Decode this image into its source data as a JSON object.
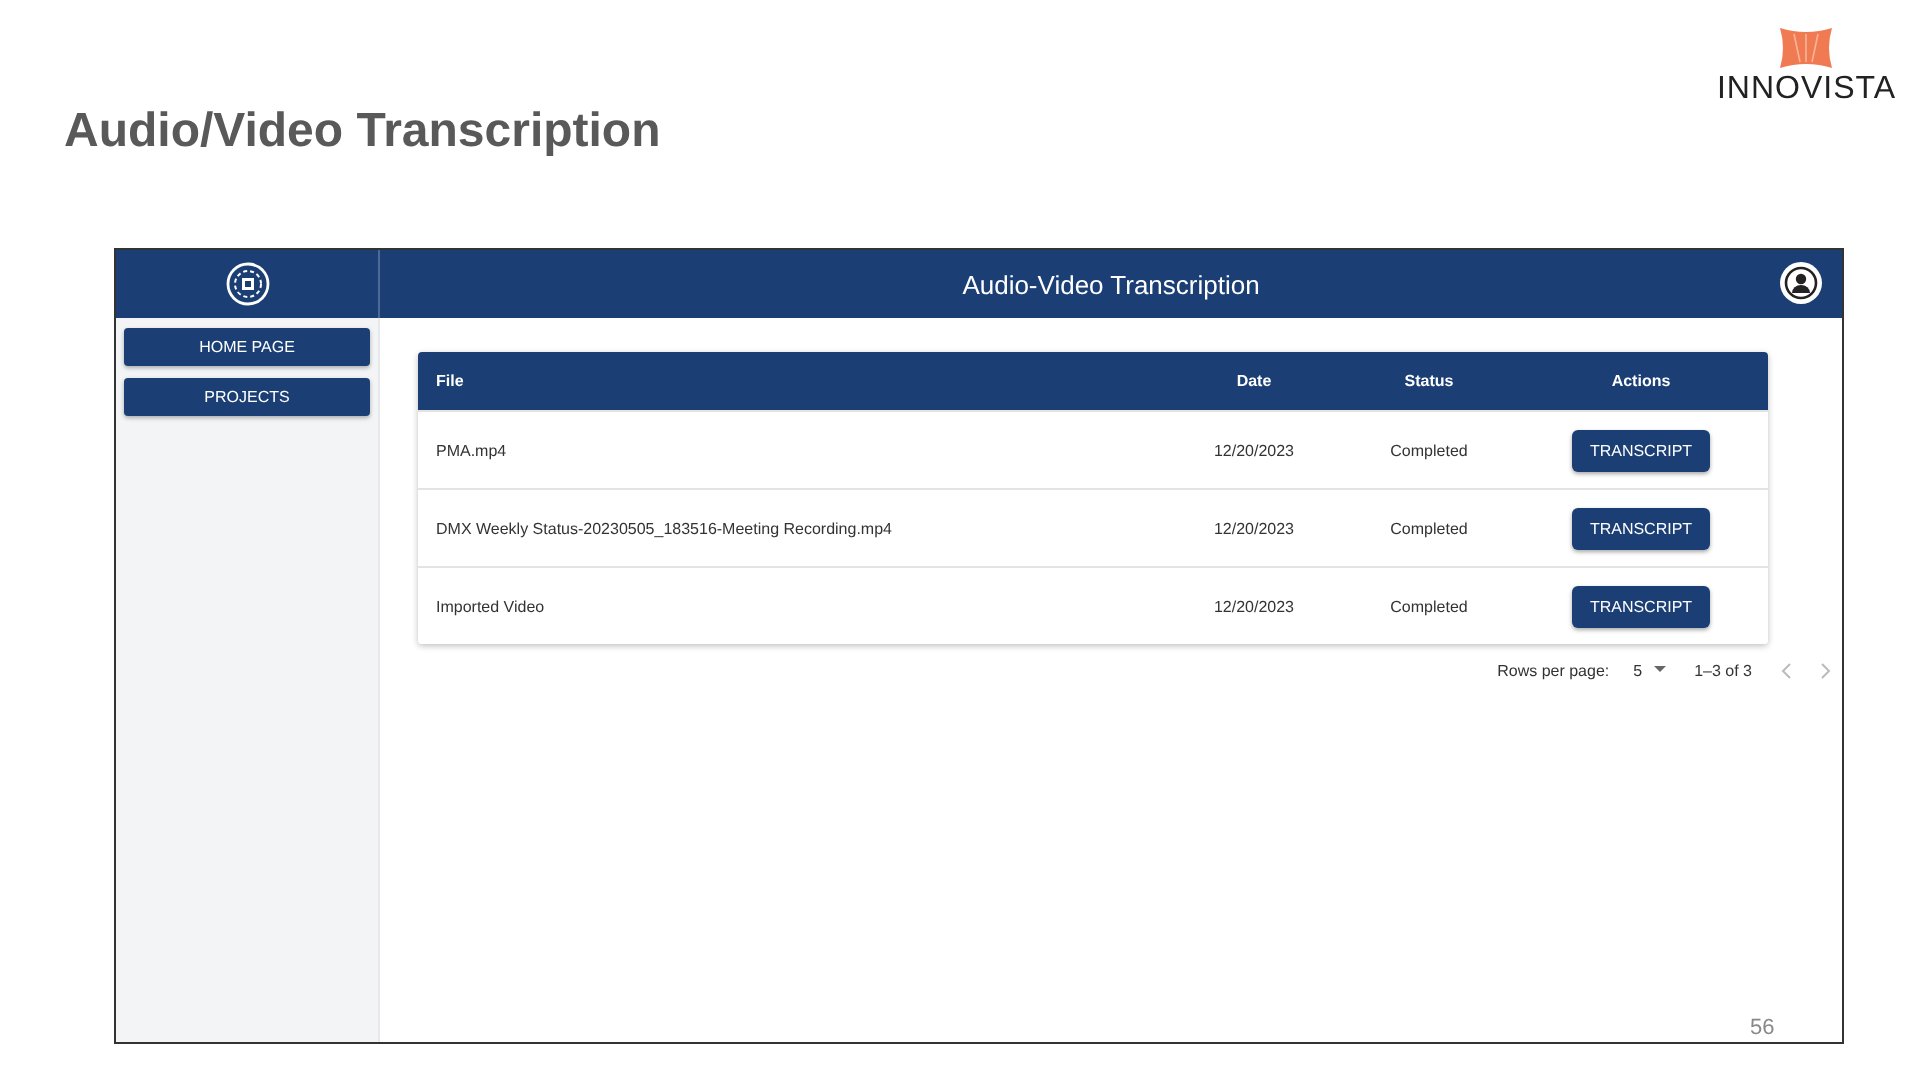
{
  "slide": {
    "title": "Audio/Video Transcription",
    "logo_text": "INNOVISTA",
    "page_number": "56"
  },
  "app": {
    "header_title": "Audio-Video Transcription",
    "sidebar": {
      "items": [
        {
          "label": "HOME PAGE"
        },
        {
          "label": "PROJECTS"
        }
      ]
    },
    "table": {
      "columns": [
        "File",
        "Date",
        "Status",
        "Actions"
      ],
      "rows": [
        {
          "file": "PMA.mp4",
          "date": "12/20/2023",
          "status": "Completed",
          "action": "TRANSCRIPT"
        },
        {
          "file": "DMX Weekly Status-20230505_183516-Meeting Recording.mp4",
          "date": "12/20/2023",
          "status": "Completed",
          "action": "TRANSCRIPT"
        },
        {
          "file": "Imported Video",
          "date": "12/20/2023",
          "status": "Completed",
          "action": "TRANSCRIPT"
        }
      ]
    },
    "pagination": {
      "rows_per_page_label": "Rows per page:",
      "rows_per_page": "5",
      "range": "1–3 of 3"
    }
  }
}
